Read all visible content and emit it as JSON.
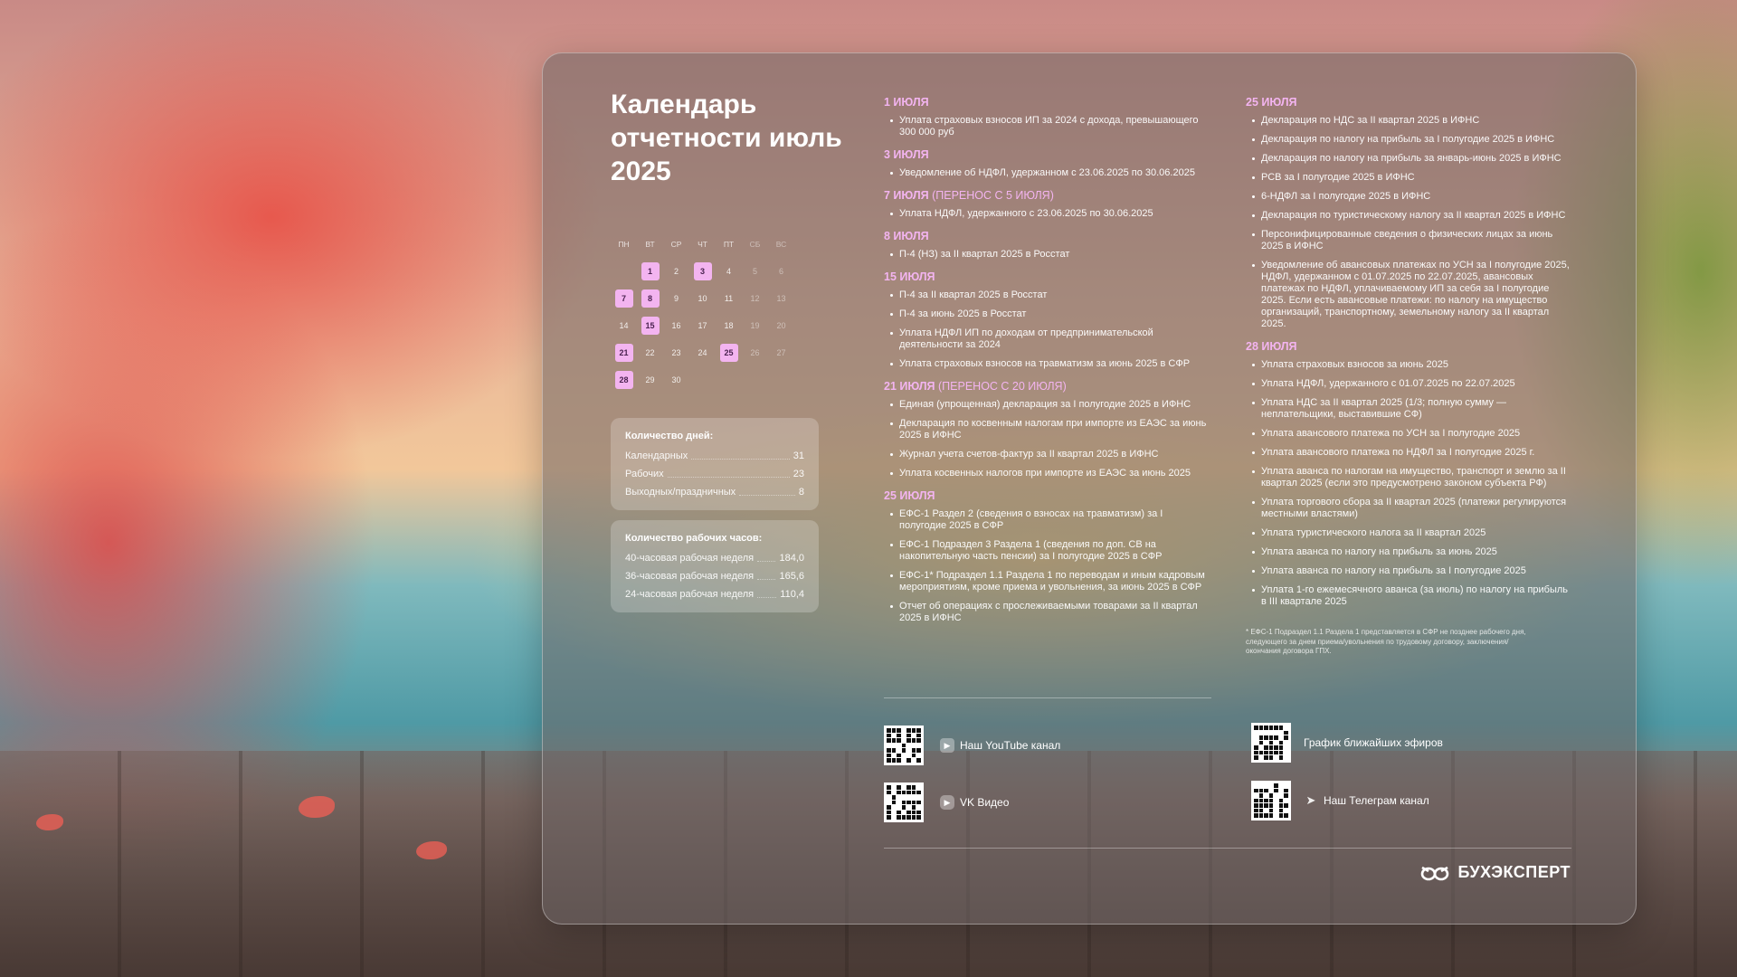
{
  "title": "Календарь отчетности июль 2025",
  "calendar": {
    "weekdays": [
      "ПН",
      "ВТ",
      "СР",
      "ЧТ",
      "ПТ",
      "СБ",
      "ВС"
    ],
    "weeks": [
      [
        "",
        "1",
        "2",
        "3",
        "4",
        "5",
        "6"
      ],
      [
        "7",
        "8",
        "9",
        "10",
        "11",
        "12",
        "13"
      ],
      [
        "14",
        "15",
        "16",
        "17",
        "18",
        "19",
        "20"
      ],
      [
        "21",
        "22",
        "23",
        "24",
        "25",
        "26",
        "27"
      ],
      [
        "28",
        "29",
        "30",
        "",
        "",
        "",
        ""
      ]
    ],
    "highlighted": [
      "1",
      "3",
      "7",
      "8",
      "15",
      "21",
      "25",
      "28"
    ],
    "highlight_color": "#f3b4f0"
  },
  "days_box": {
    "title": "Количество дней:",
    "rows": [
      {
        "label": "Календарных",
        "value": "31"
      },
      {
        "label": "Рабочих",
        "value": "23"
      },
      {
        "label": "Выходных/праздничных",
        "value": "8"
      }
    ]
  },
  "hours_box": {
    "title": "Количество рабочих часов:",
    "rows": [
      {
        "label": "40-часовая рабочая неделя",
        "value": "184,0"
      },
      {
        "label": "36-часовая рабочая неделя",
        "value": "165,6"
      },
      {
        "label": "24-часовая рабочая неделя",
        "value": "110,4"
      }
    ]
  },
  "col1": [
    {
      "date": "1 июля",
      "note": "",
      "items": [
        "Уплата страховых взносов ИП за 2024 с дохода, превышающего 300 000 руб"
      ]
    },
    {
      "date": "3 июля",
      "note": "",
      "items": [
        "Уведомление об НДФЛ, удержанном с 23.06.2025 по 30.06.2025"
      ]
    },
    {
      "date": "7 июля",
      "note": "(перенос с 5 июля)",
      "items": [
        "Уплата НДФЛ, удержанного с 23.06.2025 по 30.06.2025"
      ]
    },
    {
      "date": "8 июля",
      "note": "",
      "items": [
        "П-4 (НЗ) за II квартал 2025 в Росстат"
      ]
    },
    {
      "date": "15 июля",
      "note": "",
      "items": [
        "П-4 за II квартал 2025 в Росстат",
        "П-4 за июнь 2025 в Росстат",
        "Уплата НДФЛ ИП по доходам от предпринимательской деятельности за 2024",
        "Уплата страховых взносов на травматизм за июнь 2025 в СФР"
      ]
    },
    {
      "date": "21 июля",
      "note": "(перенос с 20 июля)",
      "items": [
        "Единая (упрощенная) декларация за I полугодие 2025 в ИФНС",
        "Декларация по косвенным налогам при импорте из ЕАЭС за июнь 2025 в ИФНС",
        "Журнал учета счетов-фактур за II квартал 2025 в ИФНС",
        "Уплата косвенных налогов при импорте из ЕАЭС за июнь 2025"
      ]
    },
    {
      "date": "25 июля",
      "note": "",
      "items": [
        "ЕФС-1 Раздел 2 (сведения о взносах на травматизм) за I полугодие 2025 в СФР",
        "ЕФС-1 Подраздел 3 Раздела 1 (сведения по доп. СВ на накопительную часть пенсии) за I полугодие 2025 в СФР",
        "ЕФС-1* Подраздел 1.1 Раздела 1 по переводам и иным кадровым мероприятиям, кроме приема и увольнения, за июнь 2025 в СФР",
        "Отчет об операциях с прослеживаемыми товарами за II квартал 2025 в ИФНС"
      ]
    }
  ],
  "col2": [
    {
      "date": "25 июля",
      "note": "",
      "items": [
        "Декларация по НДС за II квартал 2025 в ИФНС",
        "Декларация по налогу на прибыль за I полугодие 2025 в ИФНС",
        "Декларация по налогу на прибыль за январь-июнь 2025 в ИФНС",
        "РСВ за I полугодие 2025 в ИФНС",
        "6-НДФЛ за I полугодие 2025 в ИФНС",
        "Декларация по туристическому налогу за II квартал 2025 в ИФНС",
        "Персонифицированные сведения о физических лицах за июнь 2025 в ИФНС",
        "Уведомление об авансовых платежах по УСН за I полугодие 2025, НДФЛ, удержанном с 01.07.2025 по 22.07.2025, авансовых платежах по НДФЛ, уплачиваемому ИП за себя за I полугодие 2025. Если есть авансовые платежи: по налогу на имущество организаций, транспортному, земельному налогу за II квартал 2025."
      ]
    },
    {
      "date": "28 июля",
      "note": "",
      "items": [
        "Уплата страховых взносов за июнь 2025",
        "Уплата НДФЛ, удержанного с 01.07.2025 по 22.07.2025",
        "Уплата НДС за II квартал 2025 (1/3; полную сумму — неплательщики, выставившие СФ)",
        "Уплата авансового платежа по УСН за I полугодие 2025",
        "Уплата авансового платежа по НДФЛ за I полугодие 2025 г.",
        "Уплата аванса по налогам на имущество, транспорт и землю за II квартал 2025 (если это предусмотрено законом субъекта РФ)",
        "Уплата торгового сбора за II квартал 2025 (платежи регулируются местными властями)",
        "Уплата туристического налога за II квартал 2025",
        "Уплата аванса по налогу на прибыль за июнь 2025",
        "Уплата аванса по налогу на прибыль за I полугодие 2025",
        "Уплата 1-го ежемесячного аванса (за июль) по налогу на прибыль в III квартале 2025"
      ]
    }
  ],
  "footnote": "* ЕФС-1 Подраздел 1.1 Раздела 1 представляется в СФР не позднее рабочего дня, следующего за днем приема/увольнения по трудовому договору, заключения/окончания договора ГПХ.",
  "channels": {
    "youtube": {
      "label": "Наш YouTube канал",
      "icon": "youtube-icon"
    },
    "vk": {
      "label": "VK Видео",
      "icon": "vk-video-icon"
    },
    "schedule": {
      "label": "График ближайших эфиров",
      "icon": ""
    },
    "telegram": {
      "label": "Наш Телеграм канал",
      "icon": "telegram-icon"
    }
  },
  "brand": {
    "name": "БУХЭКСПЕРТ",
    "logo": "bukhexpert-logo"
  }
}
